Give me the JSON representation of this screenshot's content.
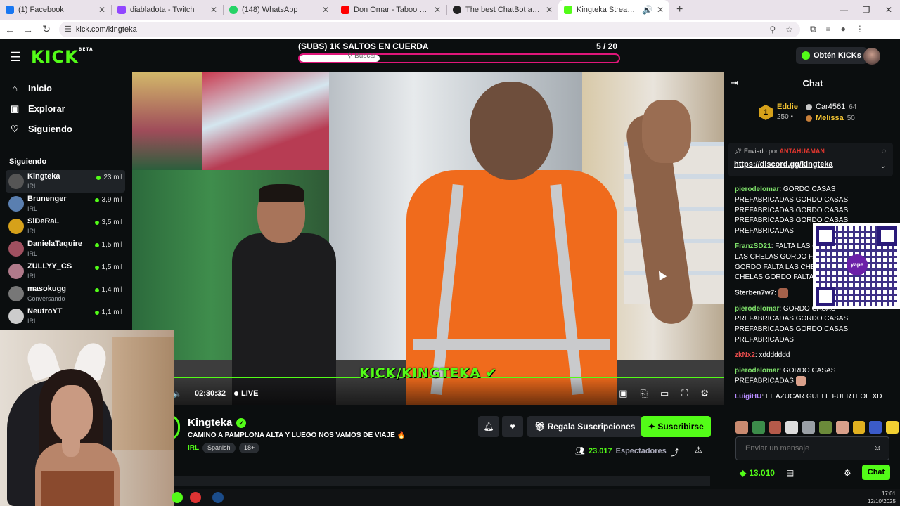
{
  "browser": {
    "tabs": [
      {
        "title": "(1) Facebook",
        "color": "#1877f2"
      },
      {
        "title": "diabladota - Twitch",
        "color": "#9146ff"
      },
      {
        "title": "(148) WhatsApp",
        "color": "#25d366"
      },
      {
        "title": "Don Omar - Taboo - YouTube",
        "color": "#ff0000"
      },
      {
        "title": "The best ChatBot and Widgets",
        "color": "#222222"
      },
      {
        "title": "Kingteka Stream - Watch Li",
        "color": "#53fc18",
        "active": true
      }
    ],
    "url": "kick.com/kingteka"
  },
  "header": {
    "logo": "KICK",
    "logo_tag": "BETA",
    "goal_title": "(SUBS) 1K SALTOS EN CUERDA",
    "goal_count": "5 / 20",
    "goal_progress": 0.25,
    "search_placeholder": "Buscar",
    "kicks_button": "Obtén KICKs"
  },
  "sidebar": {
    "nav": [
      {
        "label": "Inicio",
        "icon": "home-icon"
      },
      {
        "label": "Explorar",
        "icon": "compass-icon"
      },
      {
        "label": "Siguiendo",
        "icon": "heart-icon"
      }
    ],
    "following_title": "Siguiendo",
    "following": [
      {
        "name": "Kingteka",
        "category": "IRL",
        "viewers": "23 mil",
        "active": true
      },
      {
        "name": "Brunenger",
        "category": "IRL",
        "viewers": "3,9 mil"
      },
      {
        "name": "SiDeRaL",
        "category": "IRL",
        "viewers": "3,5 mil"
      },
      {
        "name": "DanielaTaquire",
        "category": "IRL",
        "viewers": "1,5 mil"
      },
      {
        "name": "ZULLYY_CS",
        "category": "IRL",
        "viewers": "1,5 mil"
      },
      {
        "name": "masokugg",
        "category": "Conversando",
        "viewers": "1,4 mil"
      },
      {
        "name": "NeutroYT",
        "category": "IRL",
        "viewers": "1,1 mil"
      }
    ]
  },
  "video": {
    "overlay_text": "KICK/KINGTEKA",
    "time": "02:30:32",
    "live_label": "LIVE"
  },
  "stream": {
    "channel": "Kingteka",
    "title": "CAMINO A PAMPLONA ALTA Y LUEGO NOS VAMOS DE VIAJE 🔥",
    "category": "IRL",
    "tags": [
      "Spanish",
      "18+"
    ],
    "gift_label": "Regala Suscripciones",
    "subscribe_label": "Suscribirse",
    "viewers": "23.017",
    "viewers_label": "Espectadores"
  },
  "chat": {
    "title": "Chat",
    "leaderboard": {
      "first_name": "Eddie",
      "first_score": "250",
      "others": [
        {
          "name": "Car4561",
          "score": "64"
        },
        {
          "name": "Melissa",
          "score": "50"
        }
      ]
    },
    "pinned_by_label": "Enviado por",
    "pinned_by_user": "ANTAHUAMAN",
    "pinned_link": "https://discord.gg/kingteka",
    "messages": [
      {
        "user": "pierodelomar",
        "color": "#7ee06a",
        "text": ": GORDO CASAS PREFABRICADAS GORDO CASAS PREFABRICADAS GORDO CASAS PREFABRICADAS GORDO CASAS PREFABRICADAS"
      },
      {
        "user": "FranzSD21",
        "color": "#7ee06a",
        "text": ": FALTA LAS CHELAS GORDO FALTA LAS CHELAS GORDO FALTA LAS CHELAS GORDO FALTA LAS CHELAS GORDO FALTA LAS CHELAS GORDO FALTA LAS CHELAS GORDO"
      },
      {
        "user": "Sterben7w7",
        "color": "#e9e9e9",
        "text": ":"
      },
      {
        "user": "pierodelomar",
        "color": "#7ee06a",
        "text": ": GORDO CASAS PREFABRICADAS GORDO CASAS PREFABRICADAS GORDO CASAS PREFABRICADAS"
      },
      {
        "user": "zkNx2",
        "color": "#e34b4b",
        "text": ": xddddddd"
      },
      {
        "user": "pierodelomar",
        "color": "#7ee06a",
        "text": ": GORDO CASAS PREFABRICADAS"
      },
      {
        "user": "LuigiHU",
        "color": "#b78cff",
        "text": ": EL AZUCAR GUELE FUERTEOE XD"
      }
    ],
    "input_placeholder": "Enviar un mensaje",
    "kicks_balance": "13.010",
    "send_label": "Chat"
  },
  "qr": {
    "label": "yape"
  },
  "taskbar": {
    "time": "17:01",
    "date": "12/10/2025"
  }
}
